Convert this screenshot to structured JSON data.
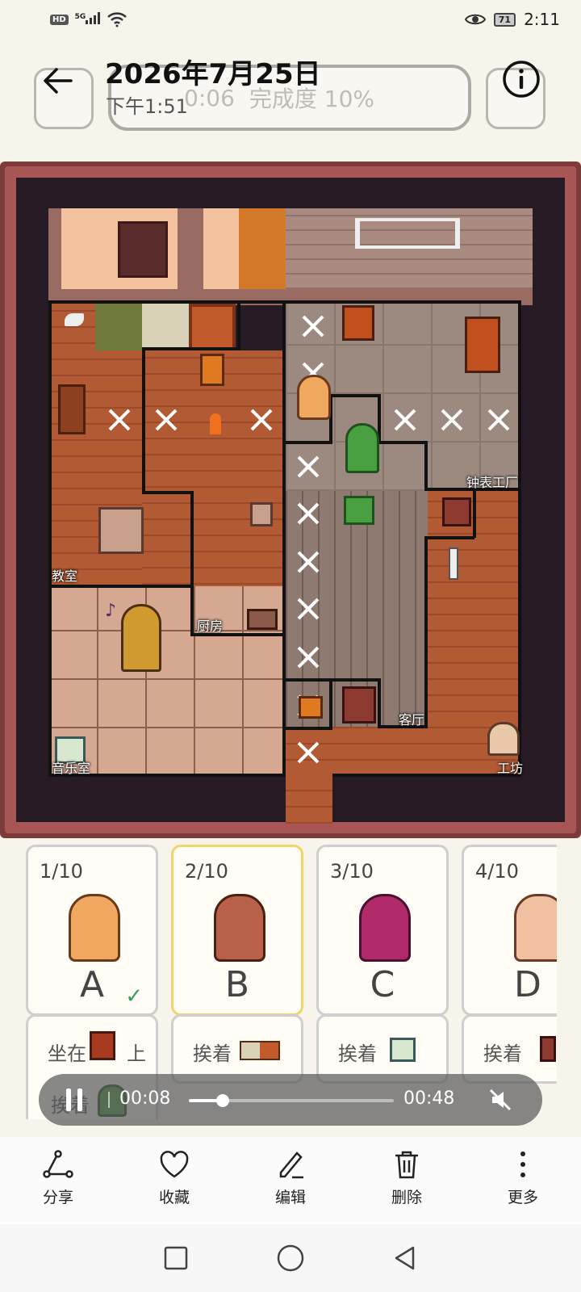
{
  "status_bar": {
    "hd": "HD",
    "network": "5G",
    "battery": "71",
    "time": "2:11"
  },
  "game_header_ghost": {
    "time": "0:06",
    "completion": "完成度 10%"
  },
  "header": {
    "title": "2026年7月25日",
    "subtitle": "下午1:51"
  },
  "map": {
    "rooms": [
      {
        "id": "classroom",
        "label": "教室"
      },
      {
        "id": "kitchen",
        "label": "厨房"
      },
      {
        "id": "clock-factory",
        "label": "钟表工厂"
      },
      {
        "id": "living-room",
        "label": "客厅"
      },
      {
        "id": "music-room",
        "label": "音乐室"
      },
      {
        "id": "workshop",
        "label": "工坊"
      }
    ]
  },
  "cards": [
    {
      "count": "1/10",
      "letter": "A",
      "checked": true,
      "condition": "坐在",
      "condition_suffix": "上",
      "extra": "挨着"
    },
    {
      "count": "2/10",
      "letter": "B",
      "selected": true,
      "condition": "挨着"
    },
    {
      "count": "3/10",
      "letter": "C",
      "condition": "挨着"
    },
    {
      "count": "4/10",
      "letter": "D",
      "condition": "挨着"
    }
  ],
  "player": {
    "current": "00:08",
    "duration": "00:48",
    "progress": 0.167
  },
  "actions": [
    {
      "id": "share",
      "label": "分享",
      "icon": "share-icon"
    },
    {
      "id": "favorite",
      "label": "收藏",
      "icon": "heart-icon"
    },
    {
      "id": "edit",
      "label": "编辑",
      "icon": "pencil-icon"
    },
    {
      "id": "delete",
      "label": "删除",
      "icon": "trash-icon"
    },
    {
      "id": "more",
      "label": "更多",
      "icon": "more-vertical-icon"
    }
  ]
}
